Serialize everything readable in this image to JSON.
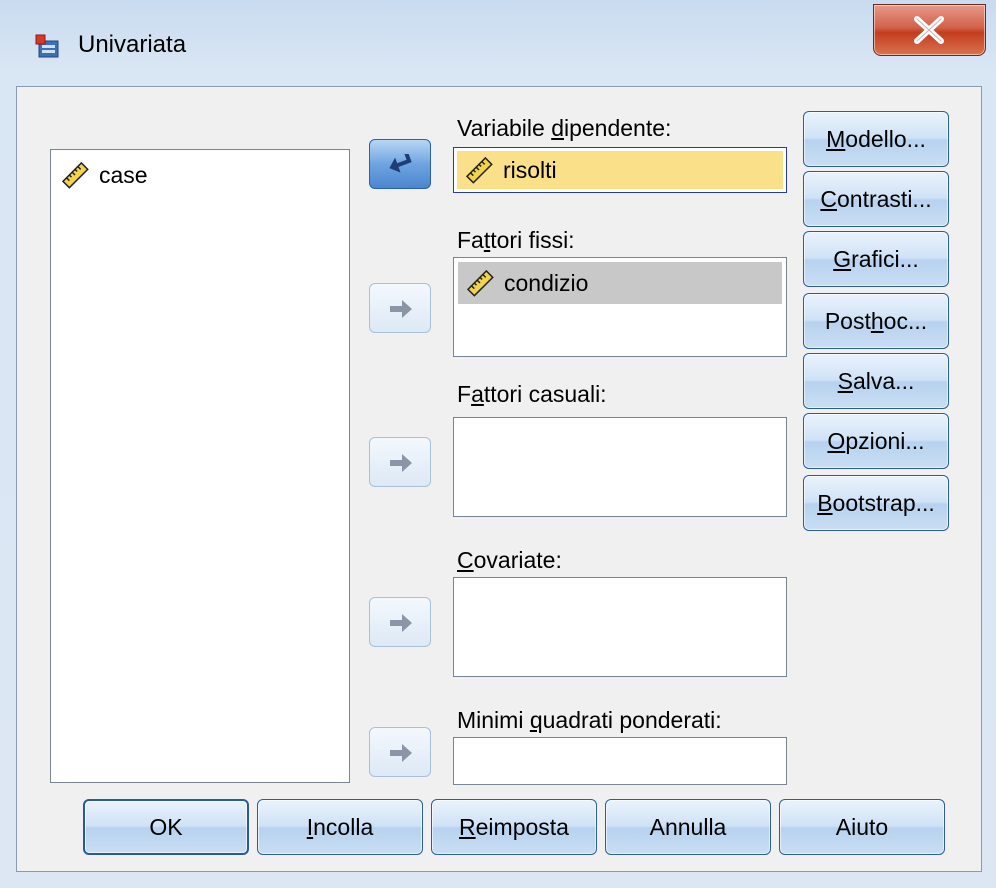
{
  "window": {
    "title": "Univariata",
    "icons": {
      "app": "spss-dialog-icon",
      "close": "close-icon"
    }
  },
  "source_list": {
    "items": [
      {
        "label": "case",
        "icon": "scale-ruler-icon"
      }
    ]
  },
  "fields": {
    "dependent": {
      "label_pre": "Variabile ",
      "label_u": "d",
      "label_post": "ipendente:",
      "value": "risolti",
      "icon": "scale-ruler-icon"
    },
    "fixed": {
      "label_pre": "Fa",
      "label_u": "t",
      "label_post": "tori fissi:",
      "items": [
        "condizio"
      ],
      "icon": "scale-ruler-icon"
    },
    "random": {
      "label_pre": "F",
      "label_u": "a",
      "label_post": "ttori casuali:"
    },
    "covariate": {
      "label_pre": "",
      "label_u": "C",
      "label_post": "ovariate:"
    },
    "wls": {
      "label_pre": "Minimi ",
      "label_u": "q",
      "label_post": "uadrati ponderati:",
      "value": ""
    }
  },
  "side_buttons": {
    "modello": {
      "pre": "",
      "u": "M",
      "post": "odello..."
    },
    "contrasti": {
      "pre": "",
      "u": "C",
      "post": "ontrasti..."
    },
    "grafici": {
      "pre": "",
      "u": "G",
      "post": "rafici..."
    },
    "posthoc": {
      "pre": "Post ",
      "u": "h",
      "post": "oc..."
    },
    "salva": {
      "pre": "",
      "u": "S",
      "post": "alva..."
    },
    "opzioni": {
      "pre": "",
      "u": "O",
      "post": "pzioni..."
    },
    "bootstrap": {
      "pre": "",
      "u": "B",
      "post": "ootstrap..."
    }
  },
  "bottom_buttons": {
    "ok": {
      "pre": "OK",
      "u": "",
      "post": ""
    },
    "incolla": {
      "pre": "",
      "u": "I",
      "post": "ncolla"
    },
    "reimposta": {
      "pre": "",
      "u": "R",
      "post": "eimposta"
    },
    "annulla": {
      "pre": "Annulla",
      "u": "",
      "post": ""
    },
    "aiuto": {
      "pre": "Aiuto",
      "u": "",
      "post": ""
    }
  },
  "colors": {
    "selected_dependent": "#fbe08a",
    "selected_fixed": "#c8c8c8",
    "button_border": "#2c5d97"
  }
}
